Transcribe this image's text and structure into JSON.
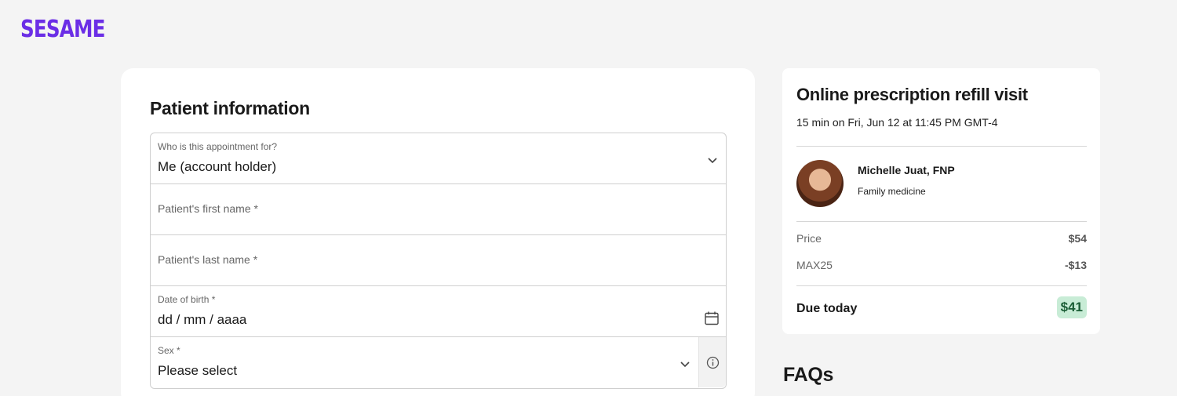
{
  "brand": {
    "logo_text": "SESAME",
    "color": "#6b2ee6"
  },
  "patient_form": {
    "title": "Patient information",
    "appointment_for": {
      "label": "Who is this appointment for?",
      "value": "Me (account holder)"
    },
    "first_name": {
      "placeholder": "Patient's first name *"
    },
    "last_name": {
      "placeholder": "Patient's last name *"
    },
    "dob": {
      "label": "Date of birth *",
      "value": "dd / mm / aaaa"
    },
    "sex": {
      "label": "Sex *",
      "value": "Please select"
    }
  },
  "summary": {
    "title": "Online prescription refill visit",
    "time": "15 min on Fri, Jun 12 at 11:45 PM GMT-4",
    "provider": {
      "name": "Michelle Juat, FNP",
      "specialty": "Family medicine"
    },
    "price_label": "Price",
    "price_value": "$54",
    "discount_label": "MAX25",
    "discount_value": "-$13",
    "due_label": "Due today",
    "due_value": "$41",
    "due_badge_color": "#c8ecd6"
  },
  "faqs": {
    "title": "FAQs"
  },
  "icons": {
    "select": "chevron-down-icon",
    "date": "calendar-icon",
    "info": "info-icon"
  }
}
